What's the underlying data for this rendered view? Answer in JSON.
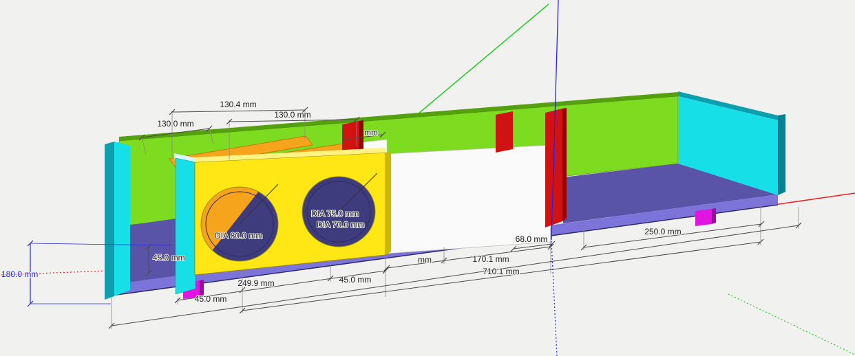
{
  "colors": {
    "bg": "#f1f1ef",
    "wall_green": "#7edc20",
    "wall_green_dark": "#55a00e",
    "floor_purple": "#5a54a8",
    "floor_dark": "#3f3c7e",
    "strip_purple": "#7c74d8",
    "strip_edge": "#2f2b6e",
    "cyan": "#17dfe8",
    "cyan_dark": "#0d9fae",
    "cyan_deep": "#0a7f92",
    "cyan_light_top": "#d9f6f8",
    "yellow": "#ffe716",
    "yellow_top": "#fff382",
    "yellow_side": "#cdb60b",
    "orange": "#f6a41c",
    "orange_dark": "#c07c08",
    "red": "#d11212",
    "red_dark": "#8e0808",
    "white_panel": "#fafafa",
    "white_edge": "#bdbdbd",
    "magenta": "#e214e2",
    "magenta_dark": "#9c0b9c",
    "dim_text": "#222222",
    "dim_blue": "#2424dd",
    "axis_red": "#ee2222",
    "axis_green": "#22cc22",
    "axis_blue": "#2222ee"
  },
  "dimensions": {
    "top_width_a": "130.4 mm",
    "top_width_b": "130.0 mm",
    "top_width_left": "130.0 mm",
    "top_partial": "mm",
    "dia_left_hole": "DIA 80.0 mm",
    "dia_outer": "DIA 75.0 mm",
    "dia_inner": "DIA 70.0 mm",
    "left_offset": "45.0 mm",
    "overall_height": "180.0 mm",
    "bottom_foot_offset": "45.0 mm",
    "bottom_chamber_width": "249.9 mm",
    "bottom_divider_offset": "45.0 mm",
    "bottom_partial": "mm",
    "mid_chamber_width": "170.1 mm",
    "overall_length": "710.1 mm",
    "gap_width": "68.0 mm",
    "right_chamber_width": "250.0 mm"
  }
}
